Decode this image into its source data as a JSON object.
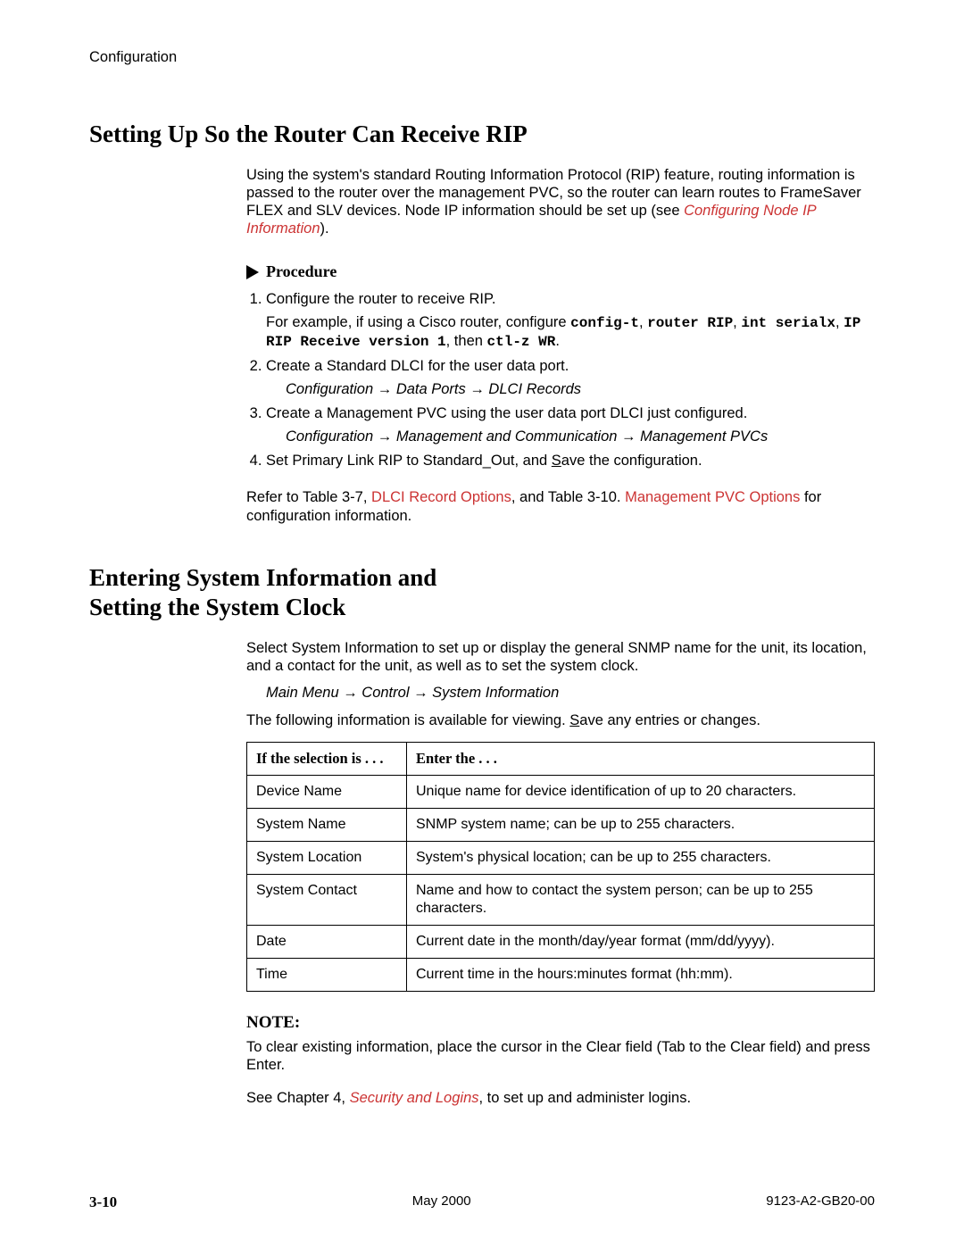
{
  "running_head": "Configuration",
  "section1": {
    "title": "Setting Up So the Router Can Receive RIP",
    "intro_a": "Using the system's standard Routing Information Protocol (RIP) feature, routing information is passed to the router over the management PVC, so the router can learn routes to FrameSaver FLEX and SLV devices. Node IP information should be set up (see ",
    "intro_link": "Configuring Node IP Information",
    "intro_b": ").",
    "procedure_label": "Procedure",
    "steps": {
      "s1": "Configure the router to receive RIP.",
      "s1b_a": "For example, if using a Cisco router, configure ",
      "s1b_m1": "config-t",
      "s1b_m2": "router RIP",
      "s1b_m3": "int serialx",
      "s1b_m4": "IP RIP Receive version 1",
      "s1b_then": ", then ",
      "s1b_m5": "ctl-z WR",
      "s2": "Create a Standard DLCI for the user data port.",
      "s2_path": "Configuration → Data Ports → DLCI Records",
      "s3": "Create a Management PVC using the user data port DLCI just configured.",
      "s3_path": "Configuration → Management and Communication → Management PVCs",
      "s4_a": "Set Primary Link RIP to Standard_Out, and ",
      "s4_save": "S",
      "s4_b": "ave the configuration."
    },
    "refer_a": "Refer to Table 3-7, ",
    "refer_link1": "DLCI Record Options",
    "refer_b": ", and Table 3-10. ",
    "refer_link2": "Management PVC Options",
    "refer_c": " for configuration information."
  },
  "section2": {
    "title_l1": "Entering System Information and",
    "title_l2": "Setting the System Clock",
    "intro": "Select System Information to set up or display the general SNMP name for the unit, its location, and a contact for the unit, as well as to set the system clock.",
    "path": "Main Menu → Control → System Information",
    "after_a": "The following information is available for viewing. ",
    "after_save": "S",
    "after_b": "ave any entries or changes.",
    "th1": "If the selection is . . .",
    "th2": "Enter the . . .",
    "rows": [
      {
        "k": "Device Name",
        "v": "Unique name for device identification of up to 20 characters."
      },
      {
        "k": "System Name",
        "v": "SNMP system name; can be up to 255 characters."
      },
      {
        "k": "System Location",
        "v": "System's physical location; can be up to 255 characters."
      },
      {
        "k": "System Contact",
        "v": "Name and how to contact the system person; can be up to 255 characters."
      },
      {
        "k": "Date",
        "v": "Current date in the month/day/year format (mm/dd/yyyy)."
      },
      {
        "k": "Time",
        "v": "Current time in the hours:minutes format (hh:mm)."
      }
    ],
    "note_label": "NOTE:",
    "note_text": "To clear existing information, place the cursor in the Clear field (Tab to the Clear field) and press Enter.",
    "see_a": "See Chapter 4, ",
    "see_link": "Security and Logins",
    "see_b": ", to set up and administer logins."
  },
  "footer": {
    "page": "3-10",
    "date": "May 2000",
    "doc": "9123-A2-GB20-00"
  }
}
